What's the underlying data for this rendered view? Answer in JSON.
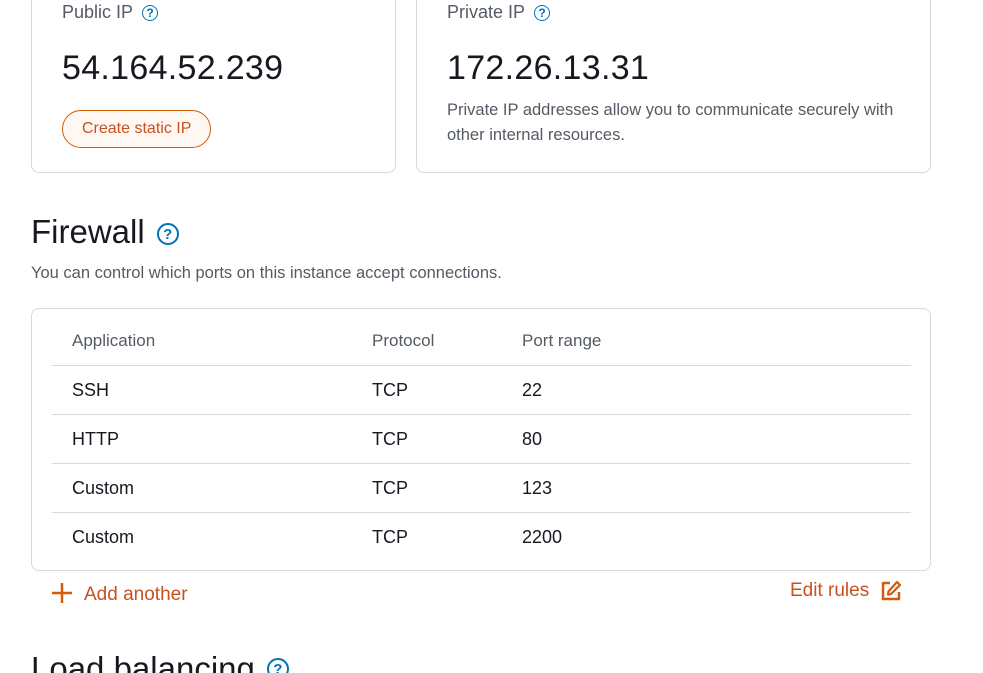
{
  "public_ip": {
    "label": "Public IP",
    "value": "54.164.52.239",
    "button_label": "Create static IP"
  },
  "private_ip": {
    "label": "Private IP",
    "value": "172.26.13.31",
    "description": "Private IP addresses allow you to communicate securely with other internal resources."
  },
  "firewall": {
    "title": "Firewall",
    "description": "You can control which ports on this instance accept connections.",
    "columns": [
      "Application",
      "Protocol",
      "Port range"
    ],
    "rows": [
      {
        "application": "SSH",
        "protocol": "TCP",
        "port_range": "22"
      },
      {
        "application": "HTTP",
        "protocol": "TCP",
        "port_range": "80"
      },
      {
        "application": "Custom",
        "protocol": "TCP",
        "port_range": "123"
      },
      {
        "application": "Custom",
        "protocol": "TCP",
        "port_range": "2200"
      }
    ],
    "add_label": "Add another",
    "edit_label": "Edit rules"
  },
  "next_section": {
    "title": "Load balancing"
  },
  "icons": {
    "help": "help-icon",
    "add": "plus-icon",
    "edit": "edit-icon"
  },
  "colors": {
    "accent": "#c7511f",
    "link_blue": "#0073bb",
    "border": "#d5dbdb"
  }
}
